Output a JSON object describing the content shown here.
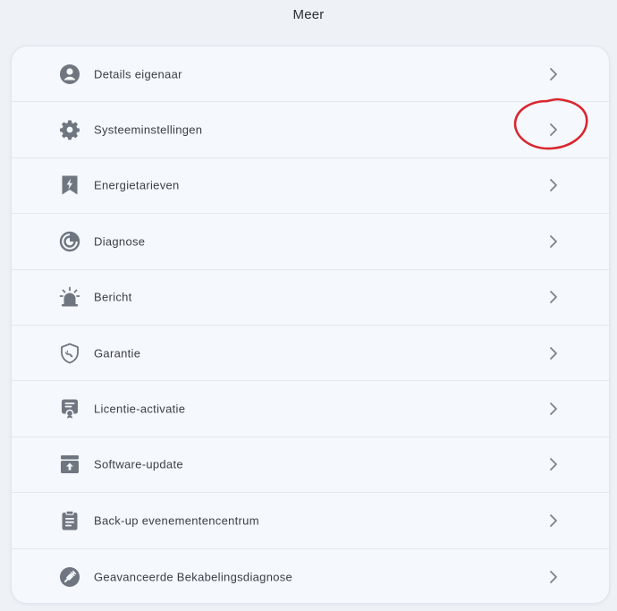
{
  "header": {
    "title": "Meer"
  },
  "colors": {
    "icon": "#707680",
    "chevron": "#7d838c",
    "annotation": "#d9262e"
  },
  "menu": {
    "items": [
      {
        "label": "Details eigenaar",
        "icon": "user-circle-icon"
      },
      {
        "label": "Systeeminstellingen",
        "icon": "gear-icon"
      },
      {
        "label": "Energietarieven",
        "icon": "lightning-bookmark-icon"
      },
      {
        "label": "Diagnose",
        "icon": "radar-chart-icon"
      },
      {
        "label": "Bericht",
        "icon": "alarm-siren-icon"
      },
      {
        "label": "Garantie",
        "icon": "shield-wrench-icon"
      },
      {
        "label": "Licentie-activatie",
        "icon": "certificate-icon"
      },
      {
        "label": "Software-update",
        "icon": "upload-box-icon"
      },
      {
        "label": "Back-up evenementencentrum",
        "icon": "clipboard-list-icon"
      },
      {
        "label": "Geavanceerde Bekabelingsdiagnose",
        "icon": "cable-plug-icon"
      }
    ]
  }
}
